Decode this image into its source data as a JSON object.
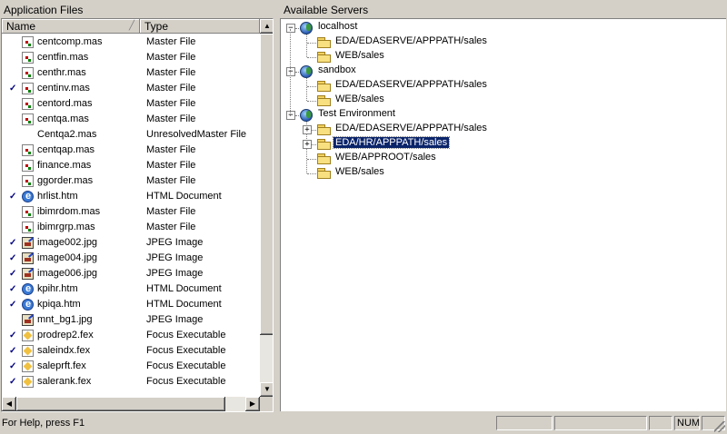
{
  "left_pane": {
    "title": "Application Files",
    "columns": {
      "name": "Name",
      "type": "Type"
    },
    "files": [
      {
        "checked": false,
        "icon": "master",
        "name": "centcomp.mas",
        "type": "Master File"
      },
      {
        "checked": false,
        "icon": "master",
        "name": "centfin.mas",
        "type": "Master File"
      },
      {
        "checked": false,
        "icon": "master",
        "name": "centhr.mas",
        "type": "Master File"
      },
      {
        "checked": true,
        "icon": "master",
        "name": "centinv.mas",
        "type": "Master File"
      },
      {
        "checked": false,
        "icon": "master",
        "name": "centord.mas",
        "type": "Master File"
      },
      {
        "checked": false,
        "icon": "master",
        "name": "centqa.mas",
        "type": "Master File"
      },
      {
        "checked": false,
        "icon": "unresolved",
        "name": "Centqa2.mas",
        "type": "UnresolvedMaster File"
      },
      {
        "checked": false,
        "icon": "master",
        "name": "centqap.mas",
        "type": "Master File"
      },
      {
        "checked": false,
        "icon": "master",
        "name": "finance.mas",
        "type": "Master File"
      },
      {
        "checked": false,
        "icon": "master",
        "name": "ggorder.mas",
        "type": "Master File"
      },
      {
        "checked": true,
        "icon": "html",
        "name": "hrlist.htm",
        "type": "HTML Document"
      },
      {
        "checked": false,
        "icon": "master",
        "name": "ibimrdom.mas",
        "type": "Master File"
      },
      {
        "checked": false,
        "icon": "master",
        "name": "ibimrgrp.mas",
        "type": "Master File"
      },
      {
        "checked": true,
        "icon": "jpg",
        "name": "image002.jpg",
        "type": "JPEG Image"
      },
      {
        "checked": true,
        "icon": "jpg",
        "name": "image004.jpg",
        "type": "JPEG Image"
      },
      {
        "checked": true,
        "icon": "jpg",
        "name": "image006.jpg",
        "type": "JPEG Image"
      },
      {
        "checked": true,
        "icon": "html",
        "name": "kpihr.htm",
        "type": "HTML Document"
      },
      {
        "checked": true,
        "icon": "html",
        "name": "kpiqa.htm",
        "type": "HTML Document"
      },
      {
        "checked": false,
        "icon": "jpg",
        "name": "mnt_bg1.jpg",
        "type": "JPEG Image"
      },
      {
        "checked": true,
        "icon": "fex",
        "name": "prodrep2.fex",
        "type": "Focus Executable"
      },
      {
        "checked": true,
        "icon": "fex",
        "name": "saleindx.fex",
        "type": "Focus Executable"
      },
      {
        "checked": true,
        "icon": "fex",
        "name": "saleprft.fex",
        "type": "Focus Executable"
      },
      {
        "checked": true,
        "icon": "fex",
        "name": "salerank.fex",
        "type": "Focus Executable"
      }
    ],
    "check_mark": "✓"
  },
  "right_pane": {
    "title": "Available Servers",
    "servers": [
      {
        "name": "localhost",
        "folders": [
          {
            "label": "EDA/EDASERVE/APPPATH/sales",
            "expandable": false,
            "selected": false
          },
          {
            "label": "WEB/sales",
            "expandable": false,
            "selected": false
          }
        ]
      },
      {
        "name": "sandbox",
        "folders": [
          {
            "label": "EDA/EDASERVE/APPPATH/sales",
            "expandable": false,
            "selected": false
          },
          {
            "label": "WEB/sales",
            "expandable": false,
            "selected": false
          }
        ]
      },
      {
        "name": "Test Environment",
        "folders": [
          {
            "label": "EDA/EDASERVE/APPPATH/sales",
            "expandable": true,
            "selected": false
          },
          {
            "label": "EDA/HR/APPPATH/sales",
            "expandable": true,
            "selected": true
          },
          {
            "label": "WEB/APPROOT/sales",
            "expandable": false,
            "selected": false
          },
          {
            "label": "WEB/sales",
            "expandable": false,
            "selected": false
          }
        ]
      }
    ]
  },
  "status_bar": {
    "help_text": "For Help, press F1",
    "panels": [
      "",
      "",
      "",
      "NUM",
      ""
    ]
  },
  "colors": {
    "selection": "#0a246a",
    "window_bg": "#d4d0c8"
  }
}
